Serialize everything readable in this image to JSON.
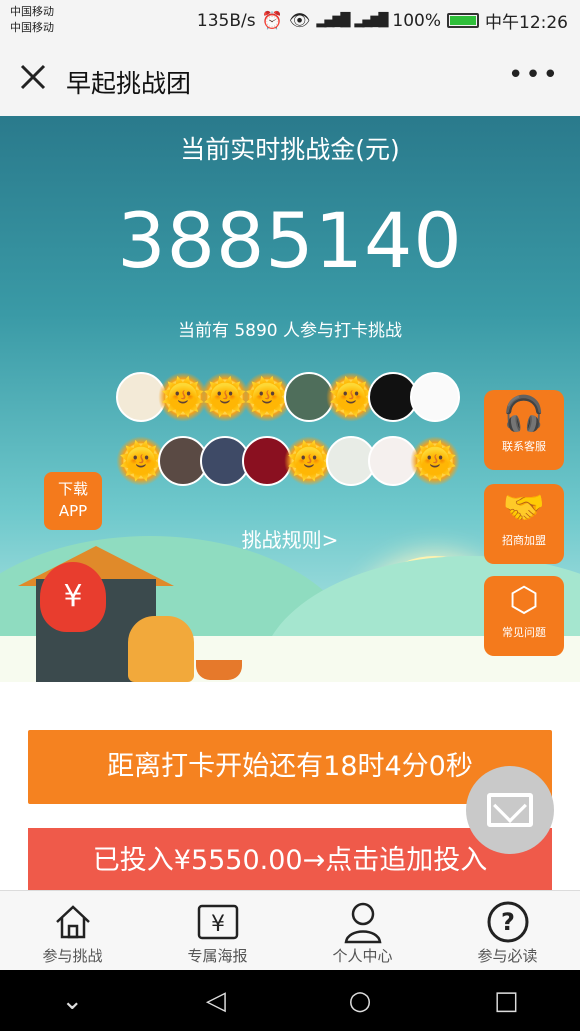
{
  "status": {
    "carrier1": "中国移动",
    "carrier2": "中国移动",
    "speed": "135B/s",
    "battery": "100%",
    "time": "中午12:26"
  },
  "header": {
    "title": "早起挑战团"
  },
  "hero": {
    "title": "当前实时挑战金(元)",
    "amount": "3885140",
    "participants": "当前有 5890 人参与打卡挑战",
    "rules": "挑战规则>",
    "download": "下载\nAPP"
  },
  "side": [
    {
      "label": "联系客服"
    },
    {
      "label": "招商加盟"
    },
    {
      "label": "常见问题"
    }
  ],
  "actions": {
    "countdown": "距离打卡开始还有18时4分0秒",
    "invested": "已投入¥5550.00→点击追加投入"
  },
  "tabs": [
    {
      "label": "参与挑战"
    },
    {
      "label": "专属海报"
    },
    {
      "label": "个人中心"
    },
    {
      "label": "参与必读"
    }
  ],
  "colors": {
    "accent": "#f58220",
    "red": "#ef5a4a",
    "hero_top": "#2a7a8c"
  }
}
